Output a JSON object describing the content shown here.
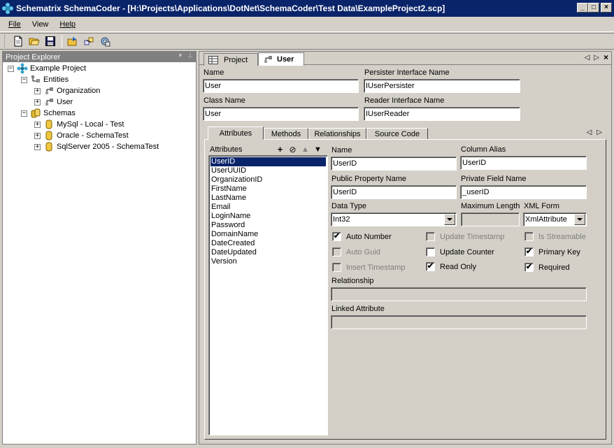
{
  "window": {
    "app_name": "Schematrix SchemaCoder",
    "title": "Schematrix SchemaCoder  - [H:\\Projects\\Applications\\DotNet\\SchemaCoder\\Test Data\\ExampleProject2.scp]",
    "minimize": "_",
    "maximize": "□",
    "close": "×"
  },
  "menu": {
    "file": "File",
    "view": "View",
    "help": "Help"
  },
  "toolbar": {
    "icons": [
      "new-file-icon",
      "open-folder-icon",
      "save-icon",
      "export-icon",
      "generate-icon",
      "settings-icon"
    ]
  },
  "explorer": {
    "title": "Project Explorer",
    "pin": "⊥",
    "dropdown": "▾",
    "tree": {
      "root": "Example Project",
      "entities_label": "Entities",
      "entities": [
        "Organization",
        "User"
      ],
      "schemas_label": "Schemas",
      "schemas": [
        "MySql - Local - Test",
        "Oracle - SchemaTest",
        "SqlServer 2005 - SchemaTest"
      ]
    }
  },
  "document_tabs": {
    "project": "Project",
    "user": "User",
    "prev": "◁",
    "next": "▷",
    "close": "×"
  },
  "entity_form": {
    "name_label": "Name",
    "name_value": "User",
    "persister_label": "Persister Interface Name",
    "persister_value": "IUserPersister",
    "class_label": "Class Name",
    "class_value": "User",
    "reader_label": "Reader Interface Name",
    "reader_value": "IUserReader"
  },
  "inner_tabs": {
    "attributes": "Attributes",
    "methods": "Methods",
    "relationships": "Relationships",
    "source_code": "Source Code",
    "prev": "◁",
    "next": "▷"
  },
  "attributes_list": {
    "label": "Attributes",
    "selected": "UserID",
    "items": [
      "UserID",
      "UserUUID",
      "OrganizationID",
      "FirstName",
      "LastName",
      "Email",
      "LoginName",
      "Password",
      "DomainName",
      "DateCreated",
      "DateUpdated",
      "Version"
    ],
    "tools": {
      "add": "+",
      "remove": "⊘",
      "up": "▲",
      "down": "▼"
    }
  },
  "attribute_form": {
    "name_label": "Name",
    "name_value": "UserID",
    "column_alias_label": "Column Alias",
    "column_alias_value": "UserID",
    "public_property_label": "Public Property Name",
    "public_property_value": "UserID",
    "private_field_label": "Private Field Name",
    "private_field_value": "_userID",
    "data_type_label": "Data Type",
    "data_type_value": "Int32",
    "max_length_label": "Maximum Length",
    "max_length_value": "",
    "xml_form_label": "XML Form",
    "xml_form_value": "XmlAttribute",
    "relationship_label": "Relationship",
    "relationship_value": "",
    "linked_attribute_label": "Linked Attribute",
    "linked_attribute_value": ""
  },
  "checkboxes": {
    "auto_number": {
      "label": "Auto Number",
      "checked": true,
      "enabled": true
    },
    "update_timestamp": {
      "label": "Update Timestamp",
      "checked": false,
      "enabled": false
    },
    "is_streamable": {
      "label": "Is Streamable",
      "checked": false,
      "enabled": false
    },
    "auto_guid": {
      "label": "Auto Guid",
      "checked": false,
      "enabled": false
    },
    "update_counter": {
      "label": "Update Counter",
      "checked": false,
      "enabled": true
    },
    "primary_key": {
      "label": "Primary Key",
      "checked": true,
      "enabled": true
    },
    "insert_timestamp": {
      "label": "Insert Timestamp",
      "checked": false,
      "enabled": false
    },
    "read_only": {
      "label": "Read Only",
      "checked": true,
      "enabled": true
    },
    "required": {
      "label": "Required",
      "checked": true,
      "enabled": true
    },
    "check_mark": "✔"
  },
  "colors": {
    "title_bar": "#0a246a",
    "face": "#d4d0c8",
    "selection": "#0a246a",
    "disabled_text": "#808080"
  }
}
